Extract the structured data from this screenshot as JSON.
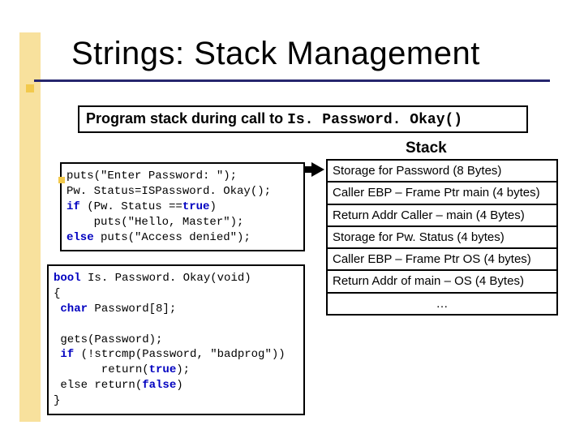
{
  "title": "Strings: Stack Management",
  "subtitle_prefix": "Program stack during call to ",
  "subtitle_code": "Is. Password. Okay()",
  "stack_label": "Stack",
  "code1": {
    "l1": "puts(\"Enter Password: \");",
    "l2": "Pw. Status=ISPassword. Okay();",
    "l3_a": "if",
    "l3_b": " (Pw. Status ==",
    "l3_c": "true",
    "l3_d": ")",
    "l4": "    puts(\"Hello, Master\");",
    "l5_a": "else",
    "l5_b": " puts(\"Access denied\");"
  },
  "code2": {
    "l1_a": "bool",
    "l1_b": " Is. Password. Okay(void)",
    "l2": "{",
    "l3_a": " char",
    "l3_b": " Password[8];",
    "blank": "",
    "l4": " gets(Password);",
    "l5_a": " if",
    "l5_b": " (!strcmp(Password, \"badprog\"))",
    "l6_a": "       return(",
    "l6_b": "true",
    "l6_c": ");",
    "l7_a": " else return(",
    "l7_b": "false",
    "l7_c": ")",
    "l8": "}"
  },
  "stack": {
    "c1": "Storage for Password (8 Bytes)",
    "c2": "Caller EBP – Frame Ptr main (4 bytes)",
    "c3": "Return Addr Caller – main (4 Bytes)",
    "c4": "Storage for Pw. Status (4 bytes)",
    "c5": "Caller EBP – Frame Ptr OS (4 bytes)",
    "c6": "Return Addr of main – OS (4 Bytes)",
    "c7": "…"
  }
}
